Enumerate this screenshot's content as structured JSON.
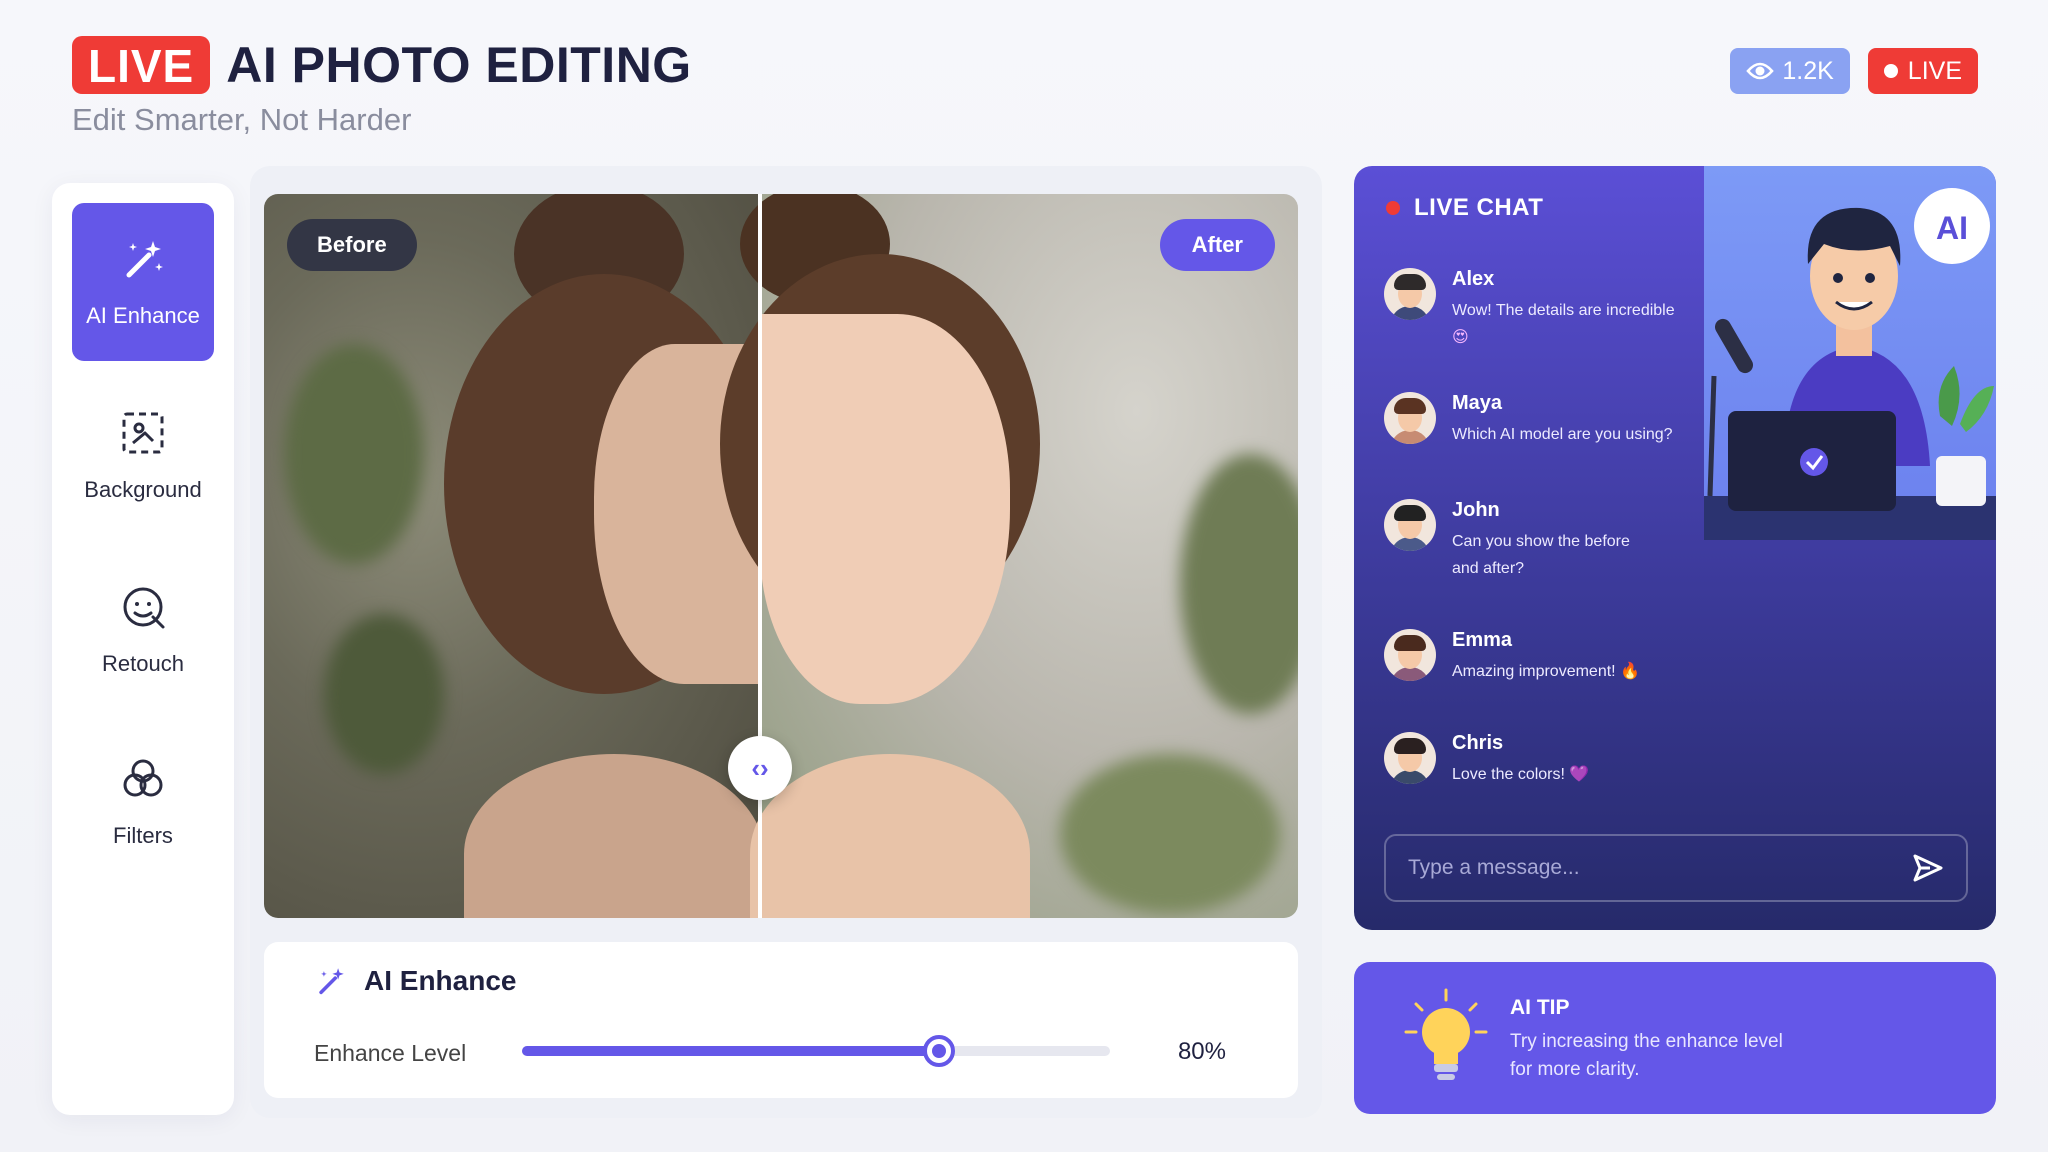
{
  "header": {
    "live_tag": "LIVE",
    "title": "AI PHOTO EDITING",
    "subtitle": "Edit Smarter, Not Harder"
  },
  "badges": {
    "viewers": "1.2K",
    "live": "LIVE"
  },
  "tools": [
    {
      "label": "AI Enhance",
      "icon": "magic-wand-icon",
      "active": true
    },
    {
      "label": "Background",
      "icon": "background-select-icon",
      "active": false
    },
    {
      "label": "Retouch",
      "icon": "face-retouch-icon",
      "active": false
    },
    {
      "label": "Filters",
      "icon": "filters-icon",
      "active": false
    }
  ],
  "editor": {
    "before_label": "Before",
    "after_label": "After",
    "split_position": 0.48
  },
  "enhance": {
    "title": "AI Enhance",
    "level_label": "Enhance Level",
    "level_value": "80%",
    "level_fraction": 0.71
  },
  "chat": {
    "title": "LIVE CHAT",
    "input_placeholder": "Type a message...",
    "messages": [
      {
        "name": "Alex",
        "text": "Wow! The details are incredible",
        "emoji": "😍"
      },
      {
        "name": "Maya",
        "text": "Which AI model are you using?",
        "emoji": ""
      },
      {
        "name": "John",
        "text": "Can you show the before and after?",
        "emoji": ""
      },
      {
        "name": "Emma",
        "text": "Amazing improvement!",
        "emoji": "🔥"
      },
      {
        "name": "Chris",
        "text": "Love the colors!",
        "emoji": "💜"
      }
    ],
    "streamer_badge": "AI"
  },
  "tip": {
    "title": "AI TIP",
    "text": "Try increasing the enhance level for more clarity."
  },
  "colors": {
    "accent": "#6457e8",
    "live_red": "#ef3b36",
    "viewer_blue": "#8aa2f2"
  }
}
